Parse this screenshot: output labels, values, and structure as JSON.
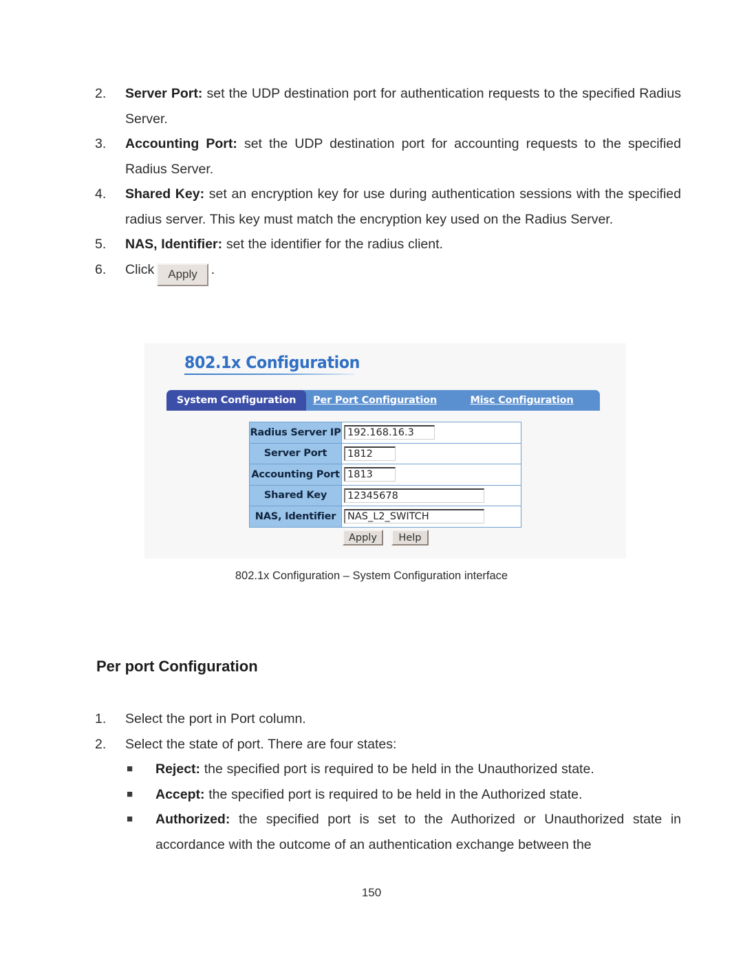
{
  "document": {
    "page_number": "150",
    "figure_caption": "802.1x Configuration – System Configuration interface",
    "section_heading": "Per port Configuration"
  },
  "top_list": {
    "items": [
      {
        "marker": "2.",
        "term": "Server Port:",
        "text": " set the UDP destination port for authentication requests to the specified Radius Server."
      },
      {
        "marker": "3.",
        "term": "Accounting Port:",
        "text": " set the UDP destination port for accounting requests to the specified Radius Server."
      },
      {
        "marker": "4.",
        "term": "Shared Key:",
        "text": " set an encryption key for use during authentication sessions with the specified radius server. This key must match the encryption key used on the Radius Server."
      },
      {
        "marker": "5.",
        "term": "NAS, Identifier:",
        "text": " set the identifier for the radius client."
      }
    ],
    "step6": {
      "marker": "6.",
      "prefix": "Click",
      "button_label": "Apply",
      "suffix": "."
    }
  },
  "bottom_list": {
    "items": [
      {
        "marker": "1.",
        "term": "",
        "text": "Select the port in Port column."
      },
      {
        "marker": "2.",
        "term": "",
        "text": "Select the state of port. There are four states:"
      }
    ],
    "bullets": [
      {
        "marker": "■",
        "term": "Reject:",
        "text": " the specified port is required to be held in the Unauthorized state."
      },
      {
        "marker": "■",
        "term": "Accept:",
        "text": " the specified port is required to be held in the Authorized state."
      },
      {
        "marker": "■",
        "term": "Authorized:",
        "text": " the specified port is set to the Authorized or Unauthorized state in accordance with the outcome of an authentication exchange between the"
      }
    ]
  },
  "screenshot": {
    "title": "802.1x Configuration",
    "tabs": [
      {
        "label": "System Configuration",
        "active": true
      },
      {
        "label": "Per Port Configuration",
        "active": false
      },
      {
        "label": "Misc Configuration",
        "active": false
      }
    ],
    "form_rows": [
      {
        "label": "Radius Server IP",
        "value": "192.168.16.3"
      },
      {
        "label": "Server Port",
        "value": "1812"
      },
      {
        "label": "Accounting Port",
        "value": "1813"
      },
      {
        "label": "Shared Key",
        "value": "12345678"
      },
      {
        "label": "NAS, Identifier",
        "value": "NAS_L2_SWITCH"
      }
    ],
    "buttons": [
      {
        "label": "Apply"
      },
      {
        "label": "Help"
      }
    ],
    "colors": {
      "title_blue": "#2f6fc4",
      "active_tab": "#3b4ea8",
      "inactive_tab": "#5b90d0",
      "label_cell": "#9ac4e9",
      "table_border": "#6f9fd0",
      "panel_bg": "#f7f7f7",
      "button_face": "#e3ded9"
    }
  }
}
